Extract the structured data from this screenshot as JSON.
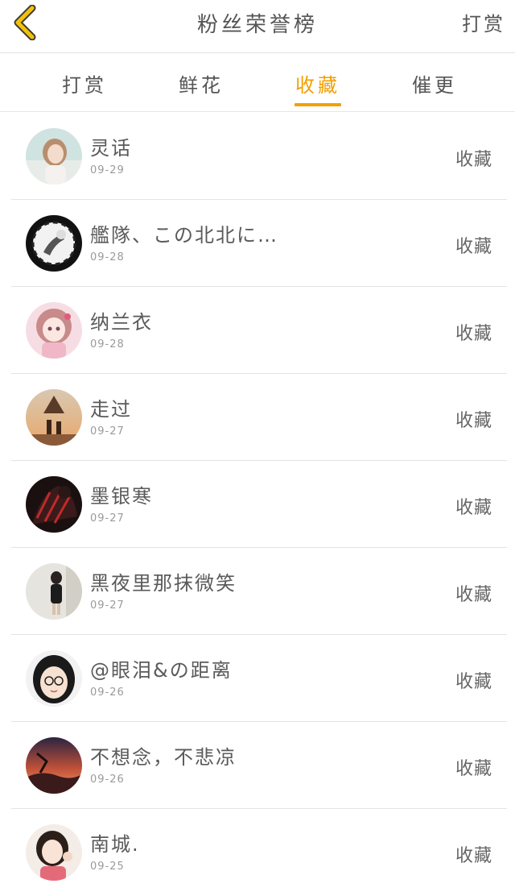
{
  "header": {
    "title": "粉丝荣誉榜",
    "reward_label": "打赏",
    "back_icon": "chevron-left-icon",
    "accent_color": "#f2a000"
  },
  "tabs": [
    {
      "label": "打赏",
      "active": false
    },
    {
      "label": "鲜花",
      "active": false
    },
    {
      "label": "收藏",
      "active": true
    },
    {
      "label": "催更",
      "active": false
    }
  ],
  "list": [
    {
      "name": "灵话",
      "date": "09-29",
      "action": "收藏"
    },
    {
      "name": "艦隊、この北北に…",
      "date": "09-28",
      "action": "收藏"
    },
    {
      "name": "纳兰衣",
      "date": "09-28",
      "action": "收藏"
    },
    {
      "name": "走过",
      "date": "09-27",
      "action": "收藏"
    },
    {
      "name": "墨银寒",
      "date": "09-27",
      "action": "收藏"
    },
    {
      "name": "黑夜里那抹微笑",
      "date": "09-27",
      "action": "收藏"
    },
    {
      "name": "@眼泪&の距离",
      "date": "09-26",
      "action": "收藏"
    },
    {
      "name": "不想念，不悲凉",
      "date": "09-26",
      "action": "收藏"
    },
    {
      "name": "南城.",
      "date": "09-25",
      "action": "收藏"
    }
  ]
}
